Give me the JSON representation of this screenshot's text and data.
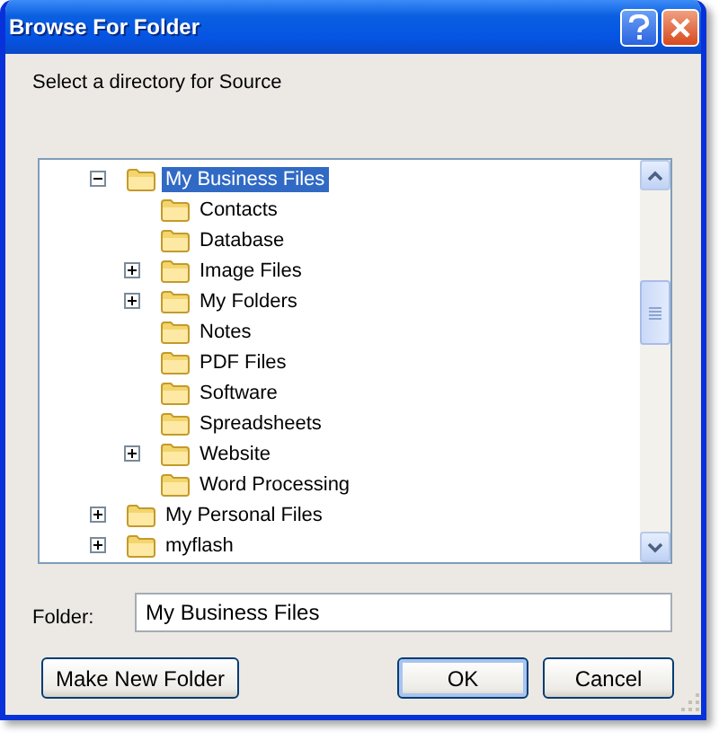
{
  "window": {
    "title": "Browse For Folder"
  },
  "prompt": "Select a directory for Source",
  "tree": [
    {
      "label": "My Business Files",
      "selected": true,
      "kind": "branch",
      "expanded": true,
      "children": [
        {
          "label": "Contacts",
          "selected": false,
          "kind": "leaf"
        },
        {
          "label": "Database",
          "selected": false,
          "kind": "leaf"
        },
        {
          "label": "Image Files",
          "selected": false,
          "kind": "branch",
          "expanded": false
        },
        {
          "label": "My Folders",
          "selected": false,
          "kind": "branch",
          "expanded": false
        },
        {
          "label": "Notes",
          "selected": false,
          "kind": "leaf"
        },
        {
          "label": "PDF Files",
          "selected": false,
          "kind": "leaf"
        },
        {
          "label": "Software",
          "selected": false,
          "kind": "leaf"
        },
        {
          "label": "Spreadsheets",
          "selected": false,
          "kind": "leaf"
        },
        {
          "label": "Website",
          "selected": false,
          "kind": "branch",
          "expanded": false
        },
        {
          "label": "Word Processing",
          "selected": false,
          "kind": "leaf"
        }
      ]
    },
    {
      "label": "My Personal Files",
      "selected": false,
      "kind": "branch",
      "expanded": false
    },
    {
      "label": "myflash",
      "selected": false,
      "kind": "branch",
      "expanded": false
    }
  ],
  "folder": {
    "label": "Folder:",
    "value": "My Business Files"
  },
  "buttons": {
    "left": "Make New Folder",
    "ok": "OK",
    "cancel": "Cancel"
  }
}
